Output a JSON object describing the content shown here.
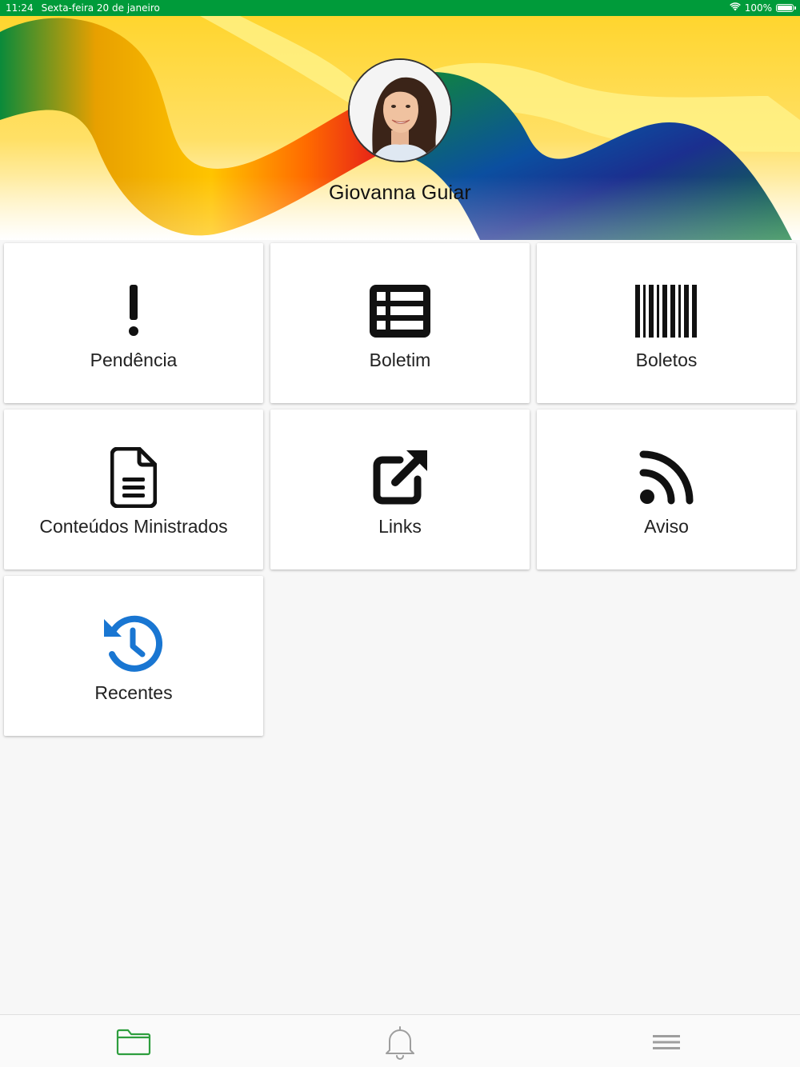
{
  "status_bar": {
    "time": "11:24",
    "date": "Sexta-feira 20 de janeiro",
    "battery": "100%"
  },
  "profile": {
    "name": "Giovanna Guiar"
  },
  "tiles": [
    {
      "label": "Pendência",
      "icon": "exclamation-icon"
    },
    {
      "label": "Boletim",
      "icon": "list-table-icon"
    },
    {
      "label": "Boletos",
      "icon": "barcode-icon"
    },
    {
      "label": "Conteúdos Ministrados",
      "icon": "document-icon"
    },
    {
      "label": "Links",
      "icon": "external-link-icon"
    },
    {
      "label": "Aviso",
      "icon": "rss-icon"
    },
    {
      "label": "Recentes",
      "icon": "history-icon"
    }
  ],
  "tab_bar": {
    "items": [
      {
        "icon": "folder-icon",
        "active": true
      },
      {
        "icon": "bell-icon",
        "active": false
      },
      {
        "icon": "menu-icon",
        "active": false
      }
    ]
  },
  "colors": {
    "status_bar": "#009b3a",
    "accent_green": "#2e9e3e",
    "history_blue": "#1976d2",
    "icon_dark": "#111111",
    "tab_inactive": "#9e9e9e"
  }
}
